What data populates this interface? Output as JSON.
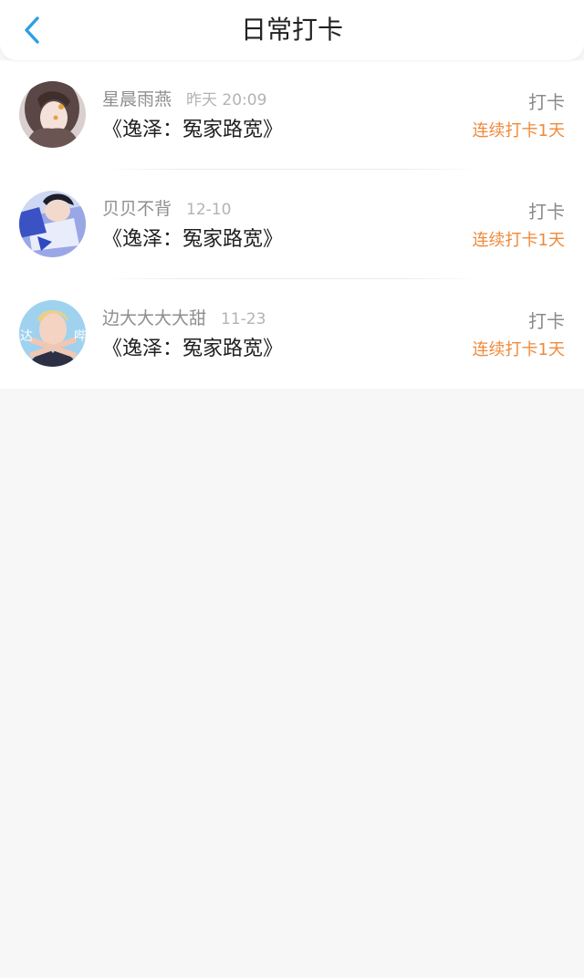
{
  "header": {
    "title": "日常打卡",
    "back_icon": "chevron-left-icon",
    "accent_color": "#2d9fe6"
  },
  "checkins": [
    {
      "username": "星晨雨燕",
      "time": "昨天 20:09",
      "book": "《逸泽：冤家路宽》",
      "action": "打卡",
      "streak": "连续打卡1天"
    },
    {
      "username": "贝贝不背",
      "time": "12-10",
      "book": "《逸泽：冤家路宽》",
      "action": "打卡",
      "streak": "连续打卡1天"
    },
    {
      "username": "边大大大大甜",
      "time": "11-23",
      "book": "《逸泽：冤家路宽》",
      "action": "打卡",
      "streak": "连续打卡1天",
      "avatar_text": [
        "达",
        "哔"
      ]
    }
  ],
  "colors": {
    "streak": "#ee8a3c",
    "page_background": "#f8f7f8"
  }
}
